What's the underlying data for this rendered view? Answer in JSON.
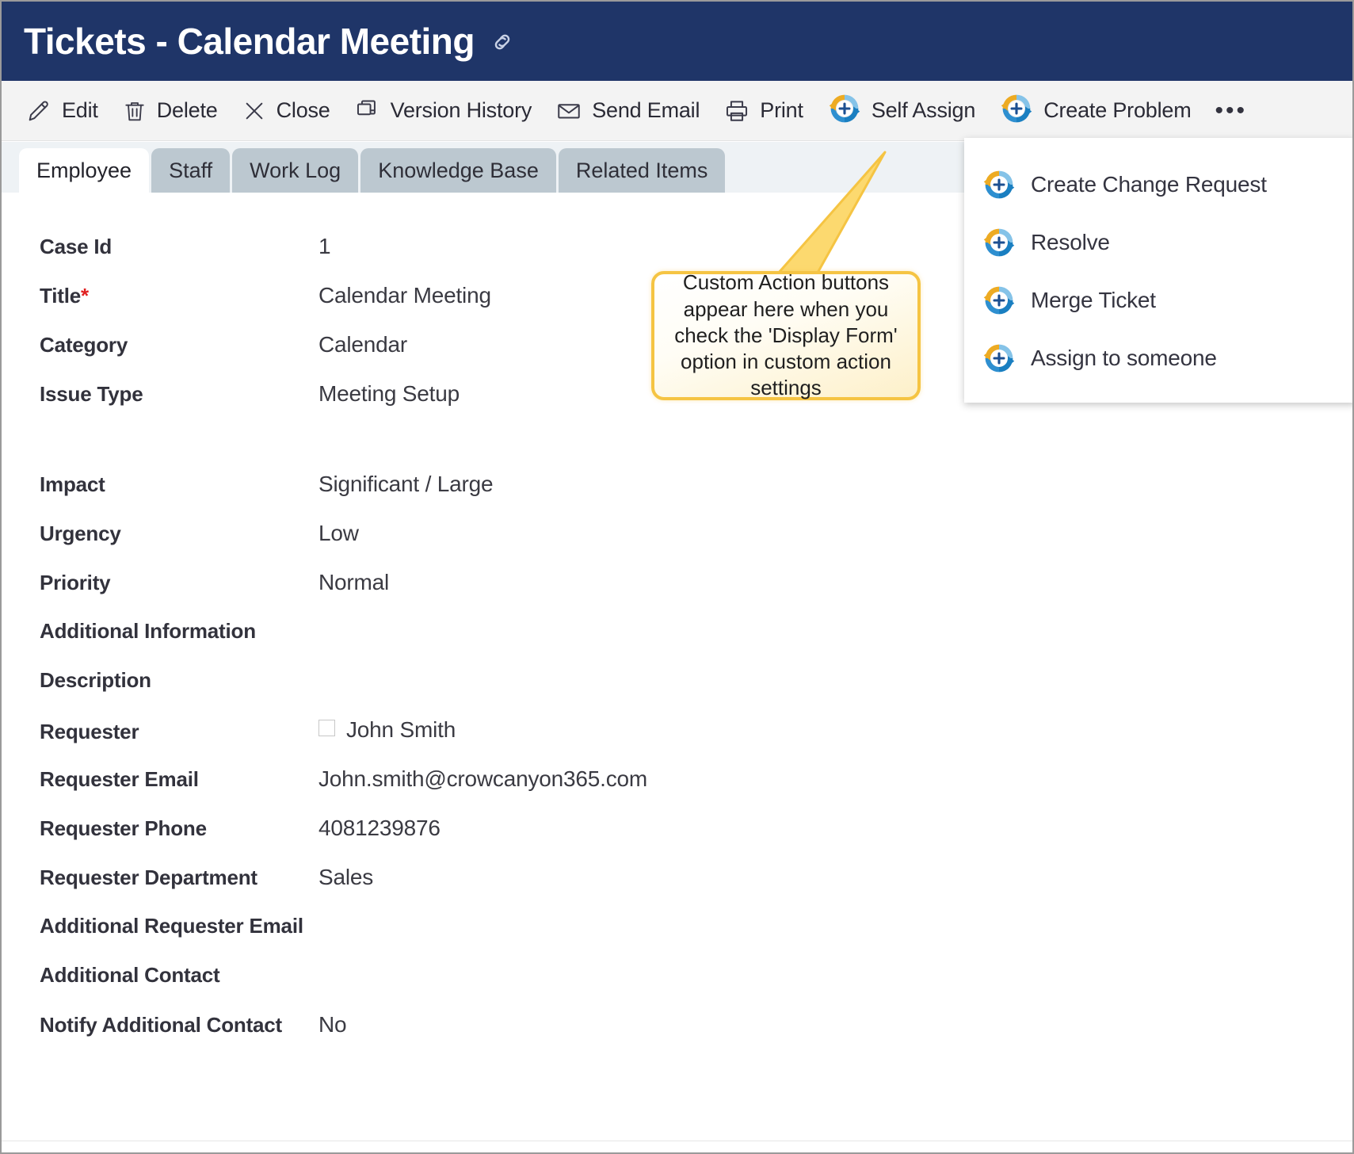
{
  "window": {
    "title": "Tickets - Calendar Meeting",
    "link_icon": "link-icon",
    "header_bg": "#1f3568"
  },
  "toolbar": {
    "items": [
      {
        "label": "Edit",
        "icon": "pencil-icon"
      },
      {
        "label": "Delete",
        "icon": "trash-icon"
      },
      {
        "label": "Close",
        "icon": "close-x-icon"
      },
      {
        "label": "Version History",
        "icon": "version-history-icon"
      },
      {
        "label": "Send Email",
        "icon": "envelope-icon"
      },
      {
        "label": "Print",
        "icon": "printer-icon"
      },
      {
        "label": "Self Assign",
        "icon": "custom-action-icon"
      },
      {
        "label": "Create Problem",
        "icon": "custom-action-icon"
      }
    ],
    "overflow_label": "•••"
  },
  "tabs": [
    {
      "label": "Employee",
      "active": true
    },
    {
      "label": "Staff",
      "active": false
    },
    {
      "label": "Work Log",
      "active": false
    },
    {
      "label": "Knowledge Base",
      "active": false
    },
    {
      "label": "Related Items",
      "active": false
    }
  ],
  "form": {
    "fields": [
      {
        "label": "Case Id",
        "value": "1",
        "required": false,
        "type": "text",
        "gap_before": false
      },
      {
        "label": "Title",
        "value": "Calendar Meeting",
        "required": true,
        "type": "text",
        "gap_before": false
      },
      {
        "label": "Category",
        "value": "Calendar",
        "required": false,
        "type": "text",
        "gap_before": false
      },
      {
        "label": "Issue Type",
        "value": "Meeting Setup",
        "required": false,
        "type": "text",
        "gap_before": false
      },
      {
        "label": "Impact",
        "value": "Significant / Large",
        "required": false,
        "type": "text",
        "gap_before": true
      },
      {
        "label": "Urgency",
        "value": "Low",
        "required": false,
        "type": "text",
        "gap_before": false
      },
      {
        "label": "Priority",
        "value": "Normal",
        "required": false,
        "type": "text",
        "gap_before": false
      },
      {
        "label": "Additional Information",
        "value": "",
        "required": false,
        "type": "text",
        "gap_before": false
      },
      {
        "label": "Description",
        "value": "",
        "required": false,
        "type": "text",
        "gap_before": false
      },
      {
        "label": "Requester",
        "value": "John Smith",
        "required": false,
        "type": "checkbox",
        "checked": false,
        "gap_before": false
      },
      {
        "label": "Requester Email",
        "value": "John.smith@crowcanyon365.com",
        "required": false,
        "type": "text",
        "gap_before": false
      },
      {
        "label": "Requester Phone",
        "value": "4081239876",
        "required": false,
        "type": "text",
        "gap_before": false
      },
      {
        "label": "Requester Department",
        "value": "Sales",
        "required": false,
        "type": "text",
        "gap_before": false
      },
      {
        "label": "Additional Requester Email",
        "value": "",
        "required": false,
        "type": "text",
        "gap_before": false
      },
      {
        "label": "Additional Contact",
        "value": "",
        "required": false,
        "type": "text",
        "gap_before": false
      },
      {
        "label": "Notify Additional Contact",
        "value": "No",
        "required": false,
        "type": "text",
        "gap_before": false
      }
    ]
  },
  "dropdown": {
    "items": [
      {
        "label": "Create Change Request",
        "icon": "custom-action-icon"
      },
      {
        "label": "Resolve",
        "icon": "custom-action-icon"
      },
      {
        "label": "Merge Ticket",
        "icon": "custom-action-icon"
      },
      {
        "label": "Assign to someone",
        "icon": "custom-action-icon"
      }
    ]
  },
  "callout": {
    "text": "Custom Action buttons appear here when you check the 'Display Form' option in custom action settings",
    "border_color": "#f5c443"
  },
  "colors": {
    "title_bar": "#1f3568",
    "toolbar_bg": "#f3f3f3",
    "tab_inactive": "#bcc8d0",
    "tab_active": "#ffffff",
    "tabstrip_bg": "#eef2f5",
    "required_star": "#e02020",
    "icon_stroke": "#3b3b4a"
  }
}
